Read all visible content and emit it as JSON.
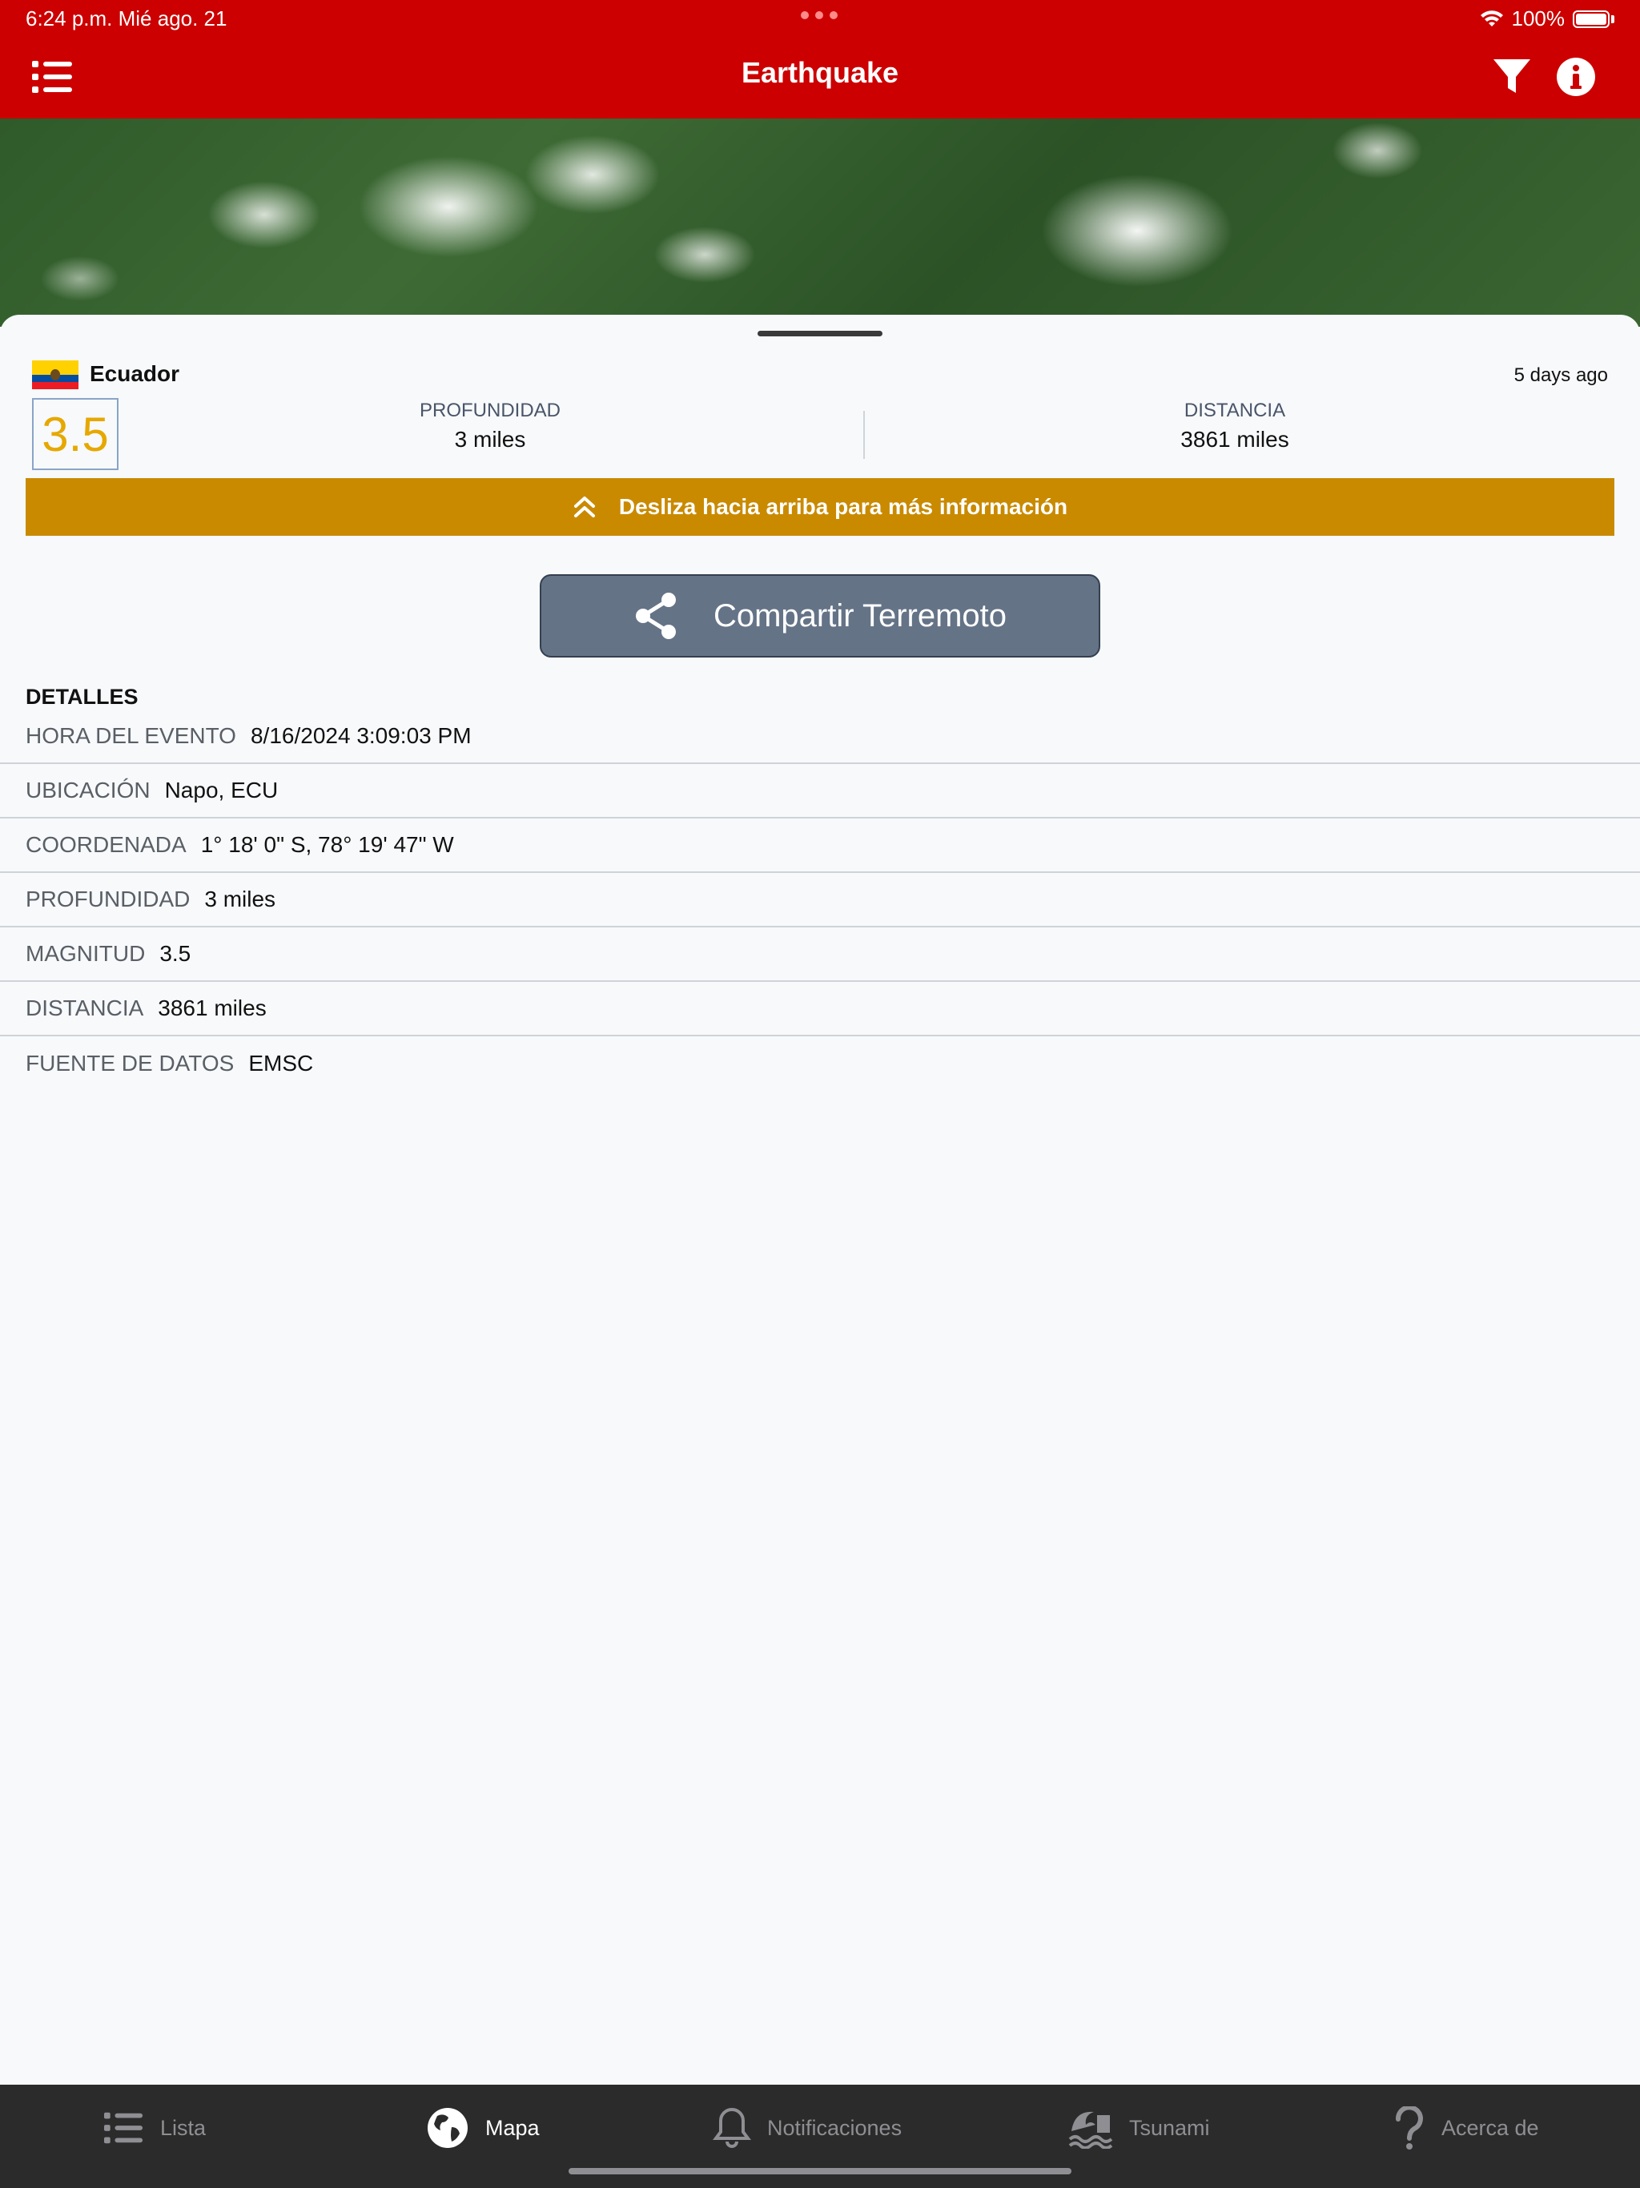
{
  "status_bar": {
    "time_date": "6:24 p.m.   Mié ago. 21",
    "battery": "100%"
  },
  "nav": {
    "title": "Earthquake",
    "left_icon": "list-icon",
    "filter_icon": "filter-icon",
    "info_icon": "info-icon"
  },
  "sheet": {
    "country": "Ecuador",
    "time_ago": "5 days ago",
    "magnitude": "3.5",
    "depth_label": "PROFUNDIDAD",
    "depth_value": "3 miles",
    "distance_label": "DISTANCIA",
    "distance_value": "3861 miles",
    "swipe_text": "Desliza hacia arriba para más información",
    "share_label": "Compartir Terremoto"
  },
  "details": {
    "title": "DETALLES",
    "rows": [
      {
        "label": "HORA DEL EVENTO",
        "value": "8/16/2024 3:09:03 PM"
      },
      {
        "label": "UBICACIÓN",
        "value": "Napo, ECU"
      },
      {
        "label": "COORDENADA",
        "value": "1° 18' 0\" S, 78° 19' 47\" W"
      },
      {
        "label": "PROFUNDIDAD",
        "value": "3 miles"
      },
      {
        "label": "MAGNITUD",
        "value": "3.5"
      },
      {
        "label": "DISTANCIA",
        "value": "3861 miles"
      },
      {
        "label": "FUENTE DE DATOS",
        "value": "EMSC"
      }
    ]
  },
  "tabs": [
    {
      "label": "Lista",
      "icon": "list-icon",
      "active": false
    },
    {
      "label": "Mapa",
      "icon": "globe-icon",
      "active": true
    },
    {
      "label": "Notificaciones",
      "icon": "bell-icon",
      "active": false
    },
    {
      "label": "Tsunami",
      "icon": "wave-icon",
      "active": false
    },
    {
      "label": "Acerca de",
      "icon": "question-icon",
      "active": false
    }
  ],
  "colors": {
    "brand_red": "#cc0000",
    "banner_gold": "#c98a00",
    "magnitude": "#e6a800",
    "share_button": "#657387",
    "tabbar": "#2b2b2b"
  }
}
